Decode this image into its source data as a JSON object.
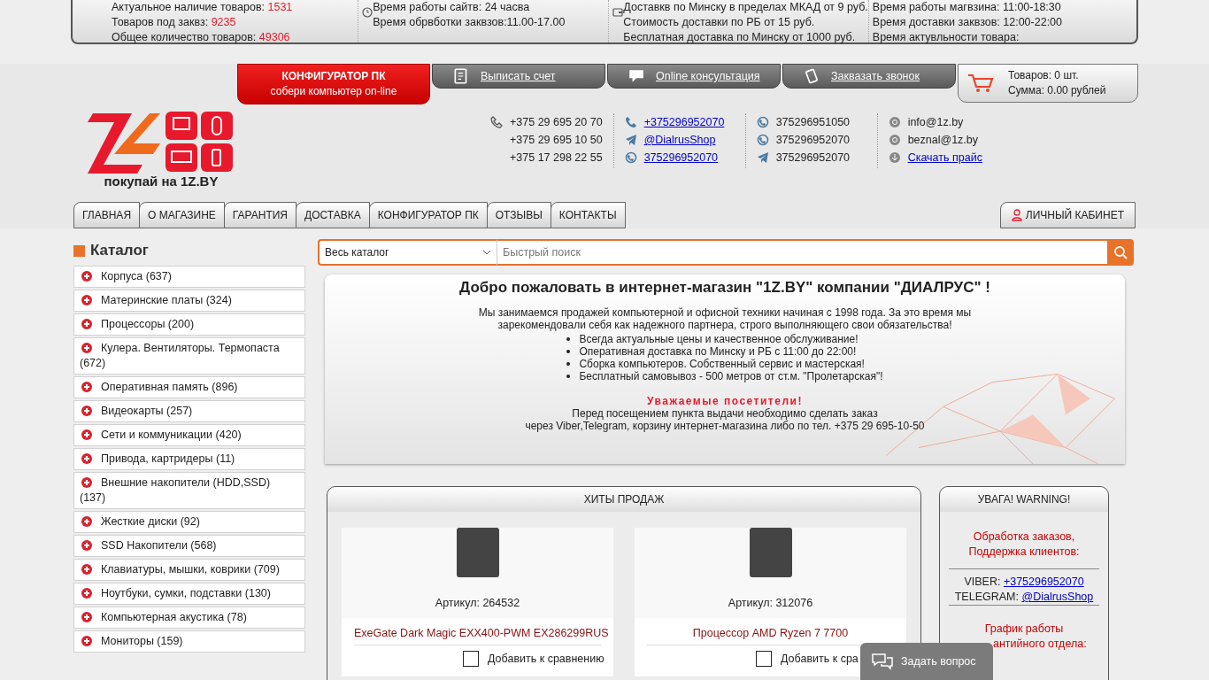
{
  "info_bar": [
    {
      "lines": [
        {
          "label": "Актуальное нaличие товаров:",
          "value": "1531"
        },
        {
          "label": "Товаров под заквз:",
          "value": "9235"
        },
        {
          "label": "Общее количество товаров:",
          "value": "49306"
        }
      ]
    },
    {
      "lines": [
        {
          "label": "Время работы сайтв: 24 часва"
        },
        {
          "label": "Время обрвботки заквзов:11.00-17.00"
        }
      ]
    },
    {
      "lines": [
        {
          "label": "Доставкв по Минску в пределах МКАД от 9 руб."
        },
        {
          "label": "Стоимость доставки по РБ от 15 руб."
        },
        {
          "label": "Бесплатная доставка по Минску от 1000 руб."
        }
      ]
    },
    {
      "lines": [
        {
          "label": "Время работы магвзина: 11:00-18:30"
        },
        {
          "label": "Время доставки заквзов: 12:00-22:00"
        },
        {
          "label": "Время актувльности товара:"
        }
      ]
    }
  ],
  "top_tabs": [
    {
      "kind": "promo",
      "label": "КОНФИГУРАТОР ПК",
      "sublabel": "собери компьютер on-line"
    },
    {
      "kind": "link",
      "label": "Выписать счет"
    },
    {
      "kind": "link",
      "label": "Online консультация"
    },
    {
      "kind": "link",
      "label": "Заквазать звонок"
    }
  ],
  "cart": {
    "items": "Товаров: 0 шт.",
    "sum": "Сумма: 0.00 рублей"
  },
  "logo": {
    "tagline": "покупай на 1Z.BY"
  },
  "contacts": [
    [
      {
        "text": "+375 29 695 20 70",
        "link": false
      },
      {
        "text": "+375 29 695 10 50",
        "link": false
      },
      {
        "text": "+375 17 298 22 55",
        "link": false
      }
    ],
    [
      {
        "text": "+375296952070",
        "link": true
      },
      {
        "text": "@DialrusShop",
        "link": true
      },
      {
        "text": "375296952070",
        "link": true
      }
    ],
    [
      {
        "text": "375296951050",
        "link": false
      },
      {
        "text": "375296952070",
        "link": false
      },
      {
        "text": "375296952070",
        "link": false
      }
    ],
    [
      {
        "text": "info@1z.by",
        "link": false
      },
      {
        "text": "beznal@1z.by",
        "link": false
      },
      {
        "text": "Скачать прайс",
        "link": true
      }
    ]
  ],
  "nav": [
    "ГЛАВНАЯ",
    "О МАГАЗИНЕ",
    "ГАРАНТИЯ",
    "ДОСТАВКА",
    "КОНФИГУРАТОР ПК",
    "ОТЗЫВЫ",
    "КОНТАКТЫ"
  ],
  "account": "ЛИЧНЫЙ КАБИНЕТ",
  "catalog": {
    "title": "Каталог",
    "items": [
      "Корпуса (637)",
      "Материнские платы (324)",
      "Процессоры (200)",
      "Кулера. Вентиляторы. Термопаста (672)",
      "Оперативная память (896)",
      "Видеокарты (257)",
      "Сети и коммуникации (420)",
      "Привода, картридеры (11)",
      "Внешние накопители (HDD,SSD) (137)",
      "Жесткие диски (92)",
      "SSD Накопители (568)",
      "Клавиатуры, мышки, коврики (709)",
      "Ноутбуки, сумки, подставки (130)",
      "Компьютерная акустика (78)",
      "Мониторы (159)"
    ]
  },
  "search": {
    "category": "Весь каталог",
    "placeholder": "Быстрый поиск"
  },
  "welcome": {
    "title": "Добро пожаловать в интернет-магазин \"1Z.BY\" компании \"ДИАЛРУС\" !",
    "intro": "Мы занимаемся продажей компьютерной и офисной техники начиная с 1998 года. За это время мы зарекомендовали себя как надежного партнера, строго выполняющего свои обязательства!",
    "bullets": [
      "Всегда актуальные цены и качественное обслуживание!",
      "Оперативная доставка по Минску и РБ с 11:00 до 22:00!",
      "Сборка компьютеров. Собственный сервис и мастерская!",
      "Бесплатный самовывоз - 500 метров от ст.м. \"Пролетарская\"!"
    ],
    "notice_title": "Уважаемые посетители!",
    "notice": [
      "Перед посещением пункта выдачи необходимо сделать заказ",
      "через Viber,Telegram, корзину интернет-магазина либо по тел. +375 29 695-10-50"
    ]
  },
  "hits": {
    "title": "ХИТЫ ПРОДАЖ",
    "products": [
      {
        "article": "Артикул: 264532",
        "name": "ExeGate Dark Magic EXX400-PWM EX286299RUS",
        "compare": "Добавить к сравнению",
        "checked": false
      },
      {
        "article": "Артикул: 312076",
        "name": "Процессор AMD Ryzen 7 7700",
        "compare": "Добавить к сра",
        "checked": false
      }
    ]
  },
  "warning": {
    "title": "УВАГА! WARNING!",
    "heading": "Обработка заказов, Поддержка клиентов:",
    "lines": [
      {
        "label": "VIBER:",
        "link": "+375296952070"
      },
      {
        "label": "TELEGRAM:",
        "link": "@DialrusShop"
      }
    ],
    "heading2": [
      "График работы",
      "антийного отдела:"
    ]
  },
  "chat_button": "Задать вопрос"
}
